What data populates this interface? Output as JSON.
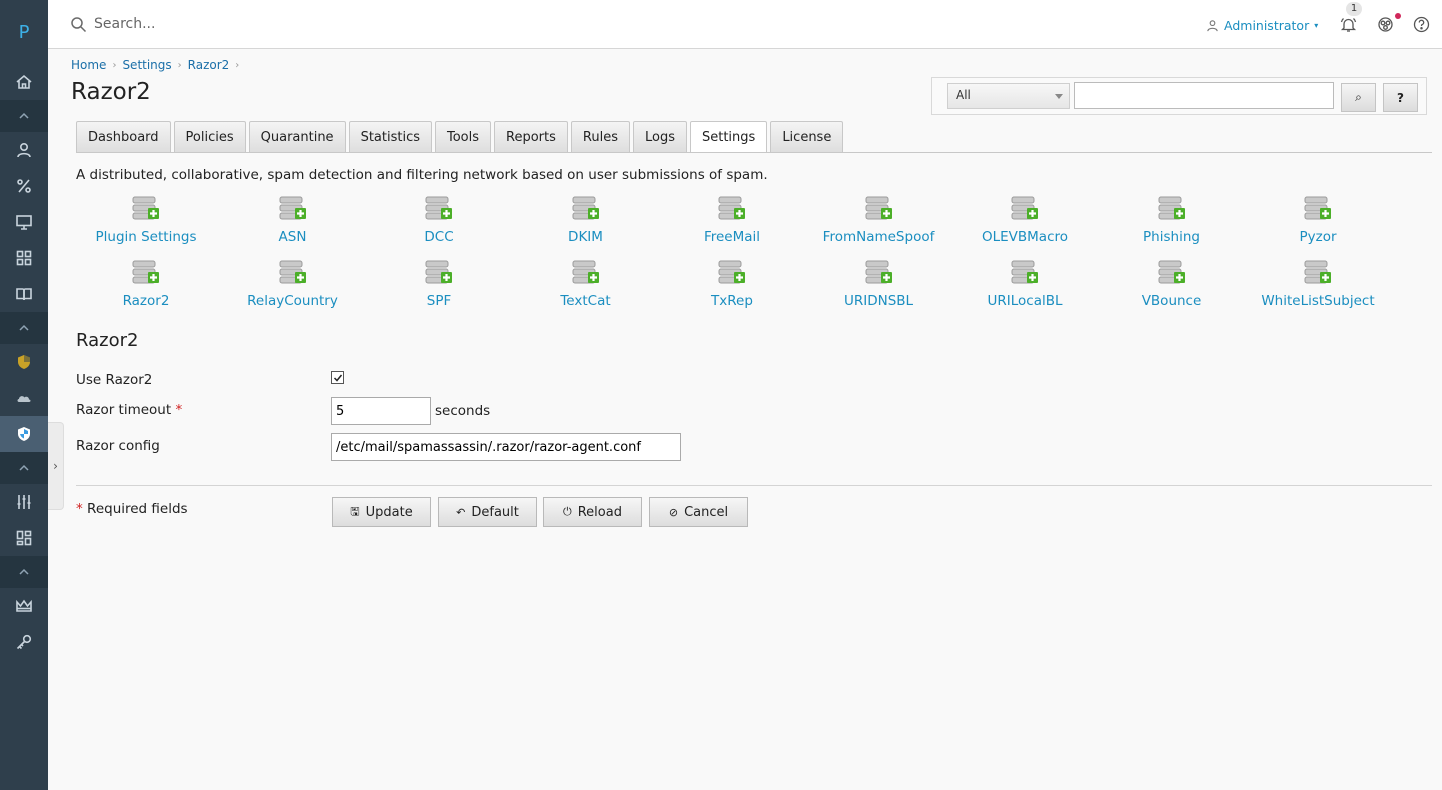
{
  "app": {
    "logo": "P"
  },
  "header": {
    "search_placeholder": "Search...",
    "user_name": "Administrator",
    "notification_count": "1"
  },
  "breadcrumb": [
    "Home",
    "Settings",
    "Razor2"
  ],
  "page_title": "Razor2",
  "filter": {
    "selected": "All",
    "search_button": "⌕",
    "help_button": "?"
  },
  "tabs": [
    {
      "label": "Dashboard",
      "active": false
    },
    {
      "label": "Policies",
      "active": false
    },
    {
      "label": "Quarantine",
      "active": false
    },
    {
      "label": "Statistics",
      "active": false
    },
    {
      "label": "Tools",
      "active": false
    },
    {
      "label": "Reports",
      "active": false
    },
    {
      "label": "Rules",
      "active": false
    },
    {
      "label": "Logs",
      "active": false
    },
    {
      "label": "Settings",
      "active": true
    },
    {
      "label": "License",
      "active": false
    }
  ],
  "description": "A distributed, collaborative, spam detection and filtering network based on user submissions of spam.",
  "plugins": [
    "Plugin Settings",
    "ASN",
    "DCC",
    "DKIM",
    "FreeMail",
    "FromNameSpoof",
    "OLEVBMacro",
    "Phishing",
    "Pyzor",
    "Razor2",
    "RelayCountry",
    "SPF",
    "TextCat",
    "TxRep",
    "URIDNSBL",
    "URILocalBL",
    "VBounce",
    "WhiteListSubject"
  ],
  "form": {
    "section_title": "Razor2",
    "use_label": "Use Razor2",
    "use_checked": true,
    "timeout_label": "Razor timeout",
    "timeout_value": "5",
    "timeout_unit": "seconds",
    "config_label": "Razor config",
    "config_value": "/etc/mail/spamassassin/.razor/razor-agent.conf",
    "required_note": "Required fields",
    "required_mark": "*"
  },
  "buttons": {
    "update": "Update",
    "default": "Default",
    "reload": "Reload",
    "cancel": "Cancel"
  },
  "colors": {
    "sidebar": "#2f3f4c",
    "link": "#1b8ec0",
    "required": "#d02020"
  }
}
